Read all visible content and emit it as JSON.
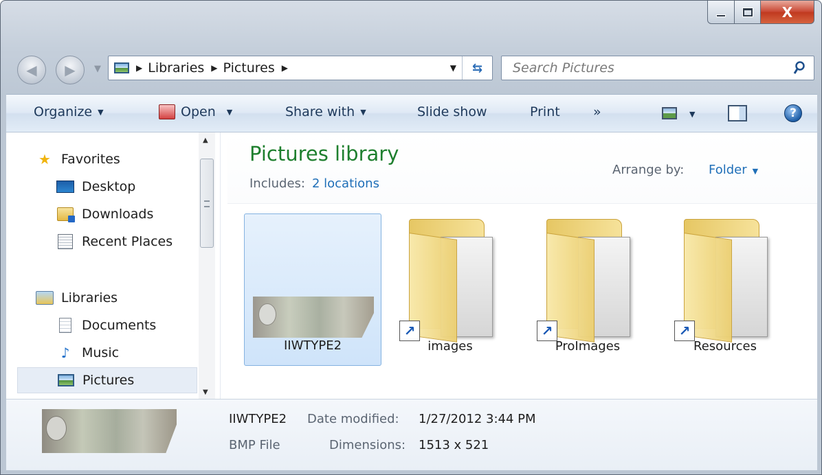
{
  "window": {
    "minimize_icon": "minimize-icon",
    "maximize_icon": "maximize-icon",
    "close_label": "X"
  },
  "address": {
    "crumbs": [
      "Libraries",
      "Pictures"
    ],
    "search_placeholder": "Search Pictures"
  },
  "toolbar": {
    "organize": "Organize",
    "open": "Open",
    "share_with": "Share with",
    "slide_show": "Slide show",
    "print": "Print",
    "more": "»",
    "help": "?"
  },
  "navpane": {
    "favorites": "Favorites",
    "desktop": "Desktop",
    "downloads": "Downloads",
    "recent_places": "Recent Places",
    "libraries": "Libraries",
    "documents": "Documents",
    "music": "Music",
    "pictures": "Pictures"
  },
  "library": {
    "title": "Pictures library",
    "includes_label": "Includes:",
    "includes_link": "2 locations",
    "arrange_label": "Arrange by:",
    "arrange_value": "Folder"
  },
  "items": [
    {
      "name": "IIWTYPE2",
      "kind": "image",
      "selected": true
    },
    {
      "name": "images",
      "kind": "folder-shortcut",
      "selected": false
    },
    {
      "name": "ProImages",
      "kind": "folder-shortcut",
      "selected": false
    },
    {
      "name": "Resources",
      "kind": "folder-shortcut",
      "selected": false
    }
  ],
  "details": {
    "name": "IIWTYPE2",
    "type": "BMP File",
    "date_label": "Date modified:",
    "date_value": "1/27/2012 3:44 PM",
    "dims_label": "Dimensions:",
    "dims_value": "1513 x 521"
  },
  "colors": {
    "library_title": "#1e7f2e",
    "link": "#1f6fb8",
    "selection": "#cfe4fa"
  }
}
